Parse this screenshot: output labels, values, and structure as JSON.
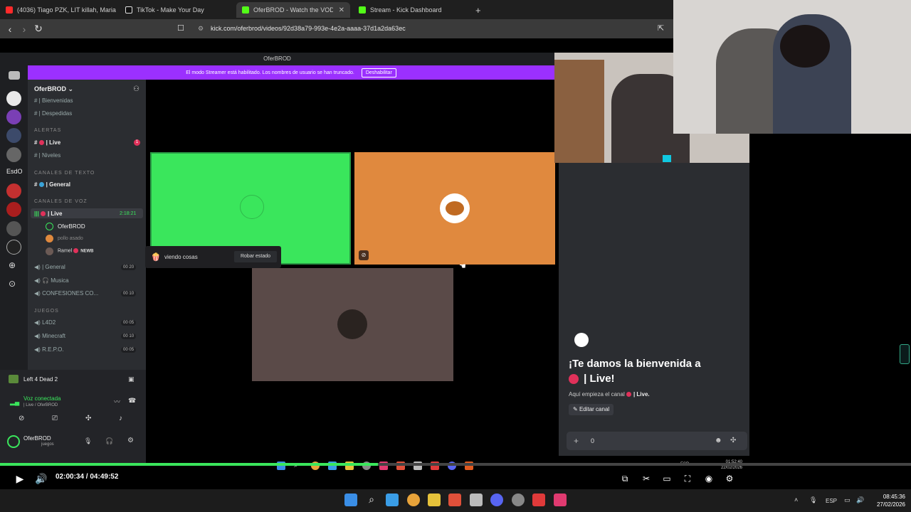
{
  "browser": {
    "tabs": [
      {
        "label": "(4036) Tiago PZK, LIT killah, Maria Be",
        "color": "#ff2a2a"
      },
      {
        "label": "TikTok - Make Your Day",
        "color": "#111"
      },
      {
        "label": "OferBROD - Watch the VOD on K",
        "color": "#53fc18",
        "active": true
      },
      {
        "label": "Stream - Kick Dashboard",
        "color": "#53fc18"
      }
    ],
    "new_tab": "+",
    "url": "kick.com/oferbrod/videos/92d38a79-993e-4e2a-aaaa-37d1a2da63ec"
  },
  "discord": {
    "window_title": "OferBROD",
    "banner_text": "El modo Streamer está habilitado. Los nombres de usuario se han truncado.",
    "banner_button": "Deshabilitar",
    "server_name": "OferBROD",
    "server_label_side": "EsdO",
    "channels_top": [
      {
        "label": "| Bienvenidas"
      },
      {
        "label": "| Despedidas"
      }
    ],
    "categories": {
      "alertas": "ALERTAS",
      "texto": "CANALES DE TEXTO",
      "voz": "CANALES DE VOZ",
      "juegos": "JUEGOS"
    },
    "alert_channels": [
      {
        "label": "| Live",
        "badge": "1"
      },
      {
        "label": "| Niveles"
      }
    ],
    "text_channels": [
      {
        "label": "| General"
      }
    ],
    "voice_live": {
      "label": "| Live",
      "timer": "2:18:21"
    },
    "voice_users": [
      {
        "name": "OferBROD"
      },
      {
        "name": "pollo asado"
      },
      {
        "name": "Ramel",
        "tag": "NEWB"
      }
    ],
    "voice_channels": [
      {
        "label": "| General",
        "a": "00",
        "b": "20"
      },
      {
        "label": "Musica"
      },
      {
        "label": "CONFESIONES CO...",
        "a": "00",
        "b": "10"
      }
    ],
    "game_channels": [
      {
        "label": "L4D2",
        "a": "00",
        "b": "05"
      },
      {
        "label": "Minecraft",
        "a": "00",
        "b": "10"
      },
      {
        "label": "R.E.P.O.",
        "a": "00",
        "b": "05"
      }
    ],
    "activity": "Left 4 Dead 2",
    "voice_connected": "Voz conectada",
    "voice_connected_sub": "| Live / OferBROD",
    "user_name": "OferBROD",
    "user_status": "juegos",
    "popup_text": "viendo cosas",
    "popup_button": "Robar estado",
    "welcome_line1": "¡Te damos la bienvenida a",
    "welcome_line2": "| Live!",
    "welcome_sub": "Aquí empieza el canal",
    "welcome_sub_channel": "| Live.",
    "edit_channel": "Editar canal",
    "msg_count": "0",
    "inner_clock_time": "01:52:40",
    "inner_clock_date": "22/02/2026",
    "inner_lang": "ESP"
  },
  "player": {
    "current": "02:00:34",
    "total": "04:49:52",
    "time_display": "02:00:34 / 04:49:52",
    "progress": 0.415
  },
  "taskbar": {
    "lang": "ESP",
    "time": "08:45:36",
    "date": "27/02/2026"
  },
  "colors": {
    "kick_green": "#53fc18",
    "streamer_purple": "#9b30ff",
    "tile_green": "#3ae65c",
    "tile_orange": "#e0893e"
  }
}
